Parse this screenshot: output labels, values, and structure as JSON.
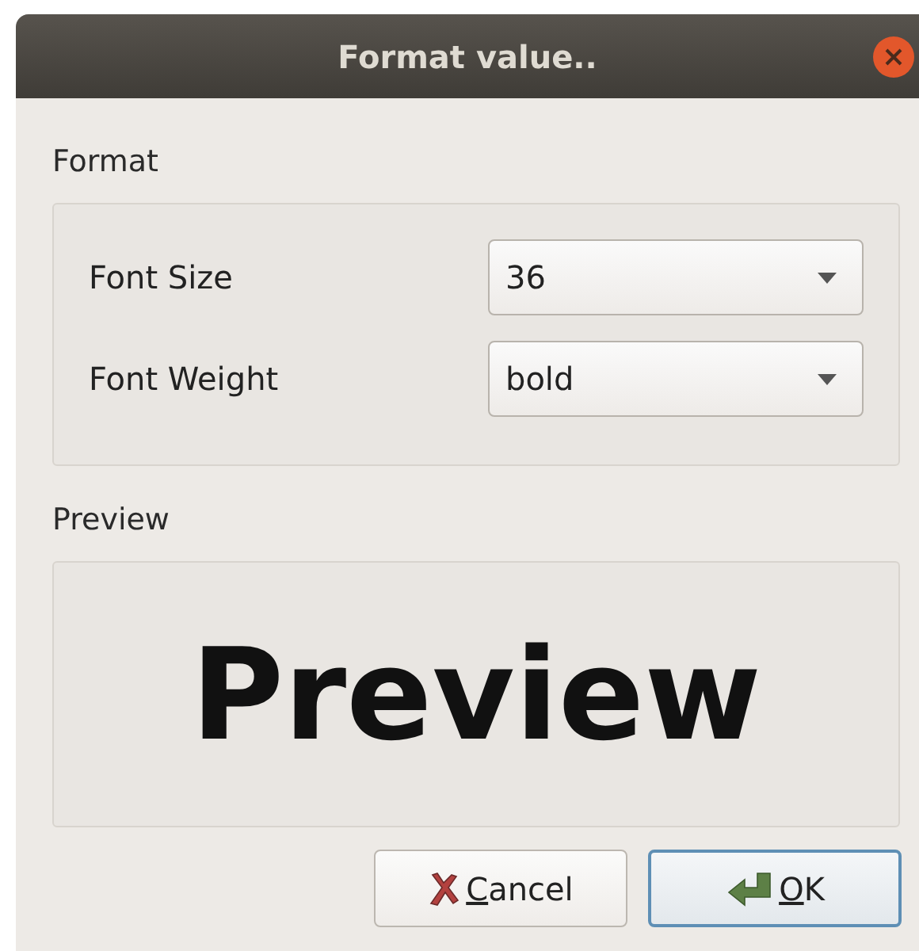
{
  "window": {
    "title": "Format value.."
  },
  "format_group": {
    "label": "Format",
    "fields": [
      {
        "label": "Font Size",
        "value": "36"
      },
      {
        "label": "Font Weight",
        "value": "bold"
      }
    ]
  },
  "preview_group": {
    "label": "Preview",
    "sample": "Preview"
  },
  "buttons": [
    {
      "kind": "cancel",
      "label": "Cancel",
      "default": false
    },
    {
      "kind": "ok",
      "label": "OK",
      "default": true
    }
  ]
}
